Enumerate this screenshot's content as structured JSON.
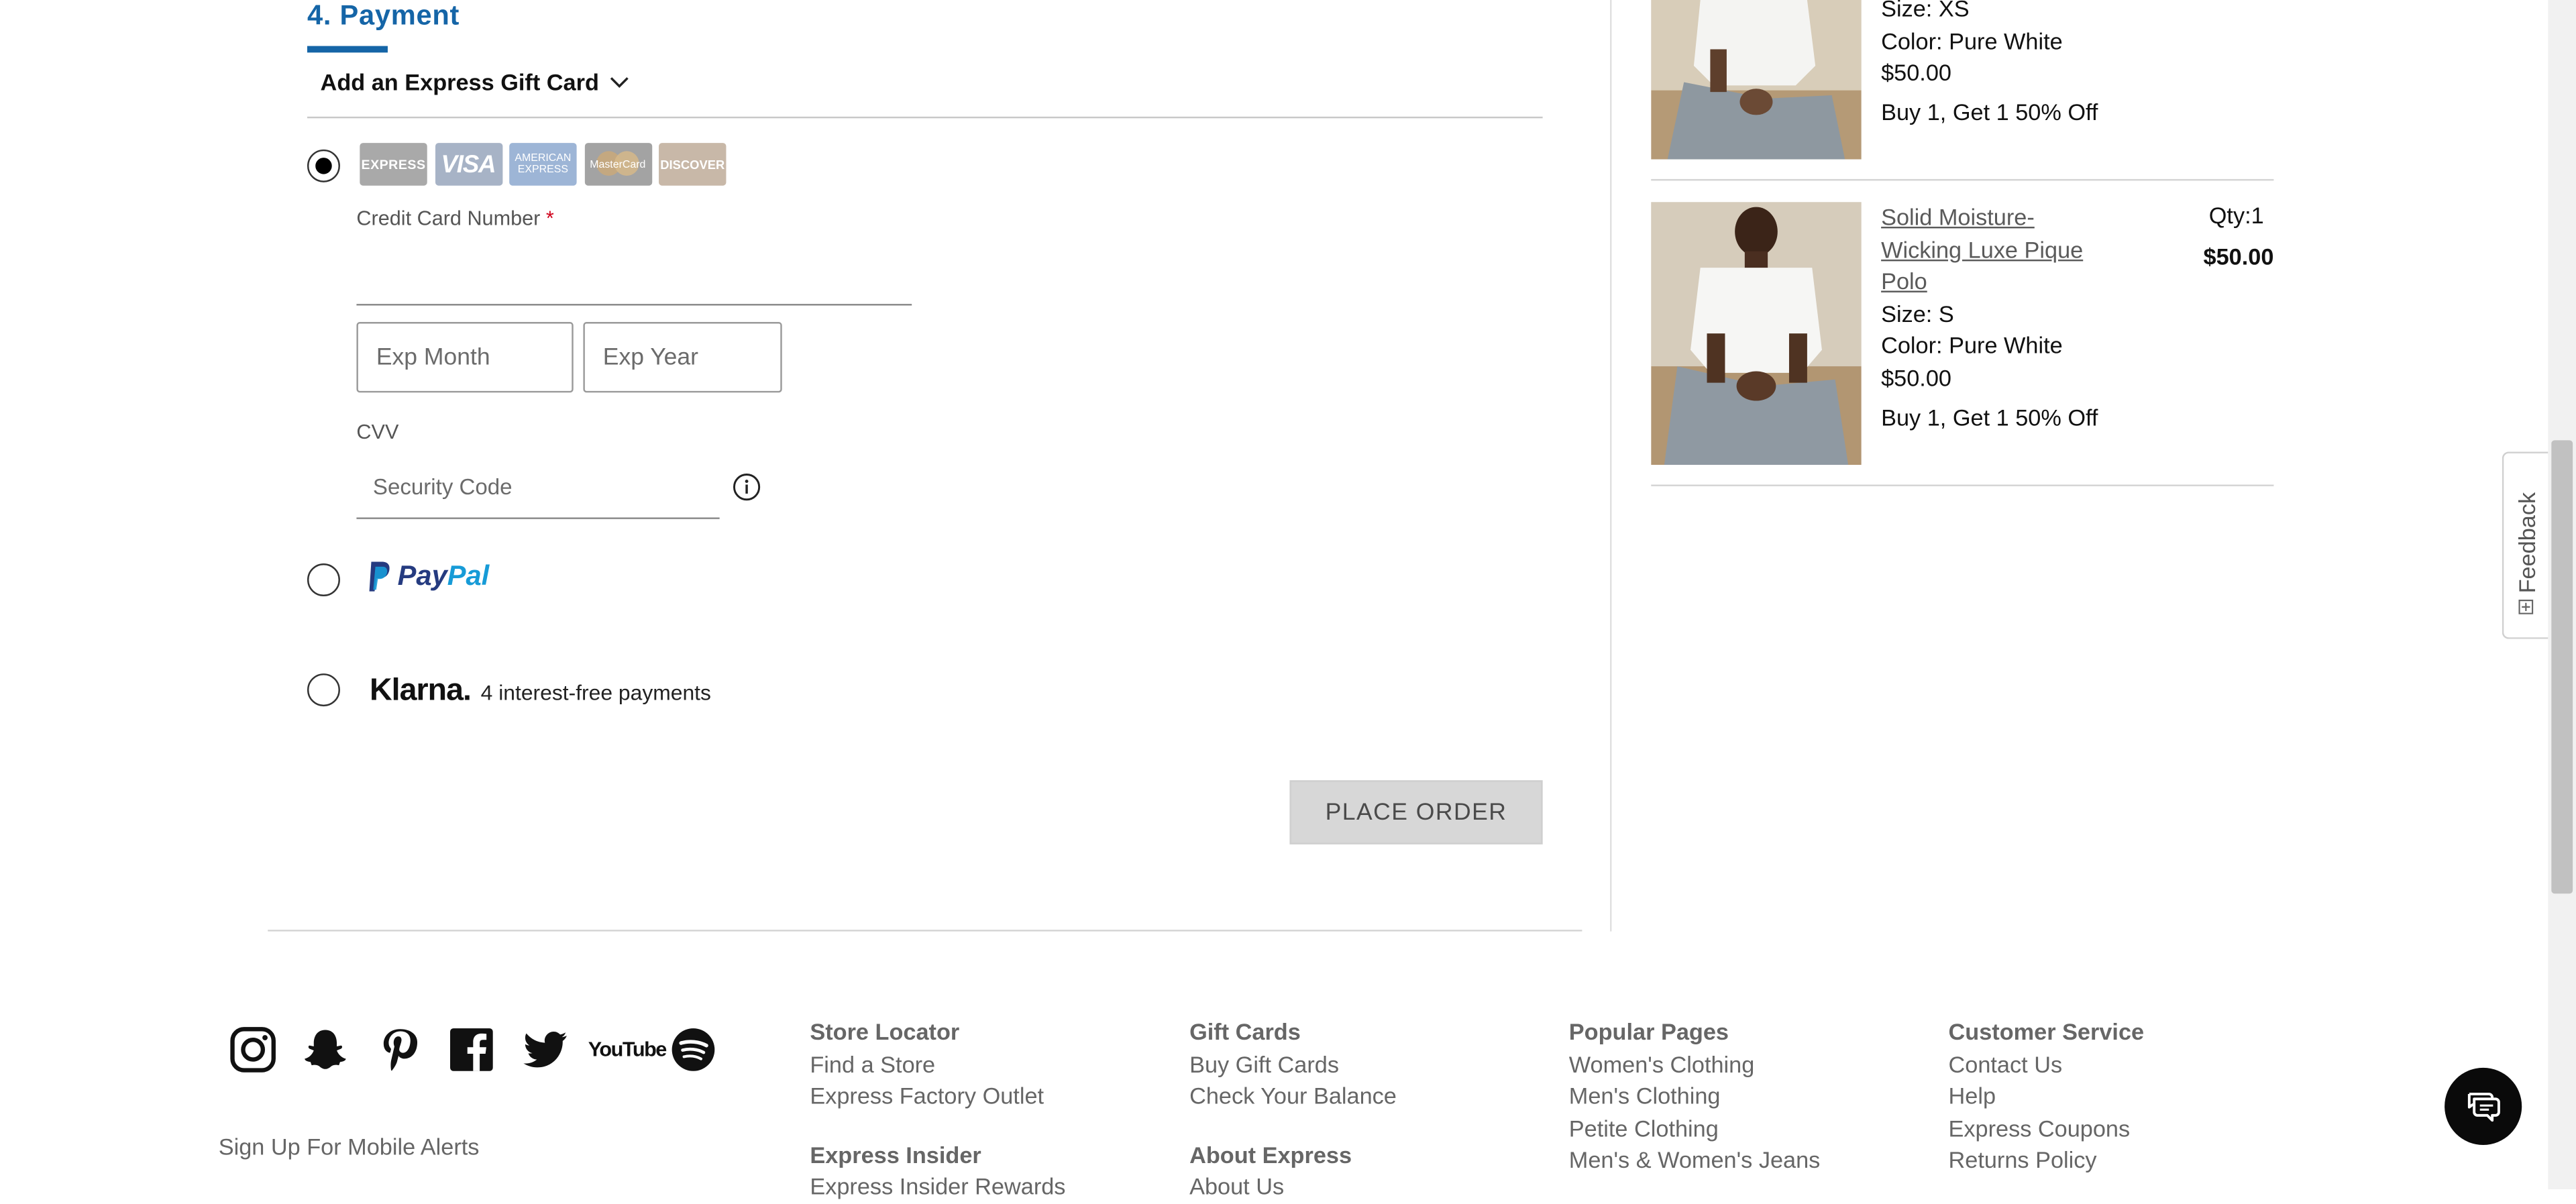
{
  "payment": {
    "section_title": "4. Payment",
    "gift_card_label": "Add an Express Gift Card",
    "card_logos": {
      "express": "EXPRESS",
      "visa": "VISA",
      "amex_line1": "AMERICAN",
      "amex_line2": "EXPRESS",
      "mastercard": "MasterCard",
      "discover": "DISCOVER"
    },
    "credit_card_label": "Credit Card Number",
    "required_marker": "*",
    "credit_card_value": "",
    "exp_month_placeholder": "Exp Month",
    "exp_year_placeholder": "Exp Year",
    "cvv_label": "CVV",
    "cvv_placeholder": "Security Code",
    "selected_method": "credit_card",
    "paypal_pay": "Pay",
    "paypal_pal": "Pal",
    "klarna_logo": "Klarna.",
    "klarna_text": "4 interest-free payments",
    "place_order": "PLACE ORDER"
  },
  "order_summary": {
    "items": [
      {
        "size": "Size: XS",
        "color": "Color: Pure White",
        "price": "$50.00",
        "promo": "Buy 1, Get 1 50% Off"
      },
      {
        "name_line1": "Solid Moisture-",
        "name_line2": "Wicking Luxe Pique",
        "name_line3": "Polo",
        "size": "Size: S",
        "color": "Color: Pure White",
        "price": "$50.00",
        "promo": "Buy 1, Get 1 50% Off",
        "qty": "Qty:1",
        "total": "$50.00"
      }
    ]
  },
  "feedback_tab": "Feedback",
  "footer": {
    "social_icons": [
      "instagram-icon",
      "snapchat-icon",
      "pinterest-icon",
      "facebook-icon",
      "twitter-icon",
      "youtube-icon",
      "spotify-icon"
    ],
    "youtube_text": "YouTube",
    "mobile_alerts": "Sign Up For Mobile Alerts",
    "columns": [
      {
        "heading": "Store Locator",
        "links": [
          "Find a Store",
          "Express Factory Outlet"
        ],
        "heading2": "Express Insider",
        "links2": [
          "Express Insider Rewards"
        ]
      },
      {
        "heading": "Gift Cards",
        "links": [
          "Buy Gift Cards",
          "Check Your Balance"
        ],
        "heading2": "About Express",
        "links2": [
          "About Us"
        ]
      },
      {
        "heading": "Popular Pages",
        "links": [
          "Women's Clothing",
          "Men's Clothing",
          "Petite Clothing",
          "Men's & Women's Jeans"
        ]
      },
      {
        "heading": "Customer Service",
        "links": [
          "Contact Us",
          "Help",
          "Express Coupons",
          "Returns Policy"
        ]
      }
    ]
  },
  "colors": {
    "accent_blue": "#1565a7",
    "button_disabled_bg": "#d7d7d7",
    "required_red": "#d0021b",
    "paypal_dark": "#253b80",
    "paypal_light": "#179bd7"
  }
}
